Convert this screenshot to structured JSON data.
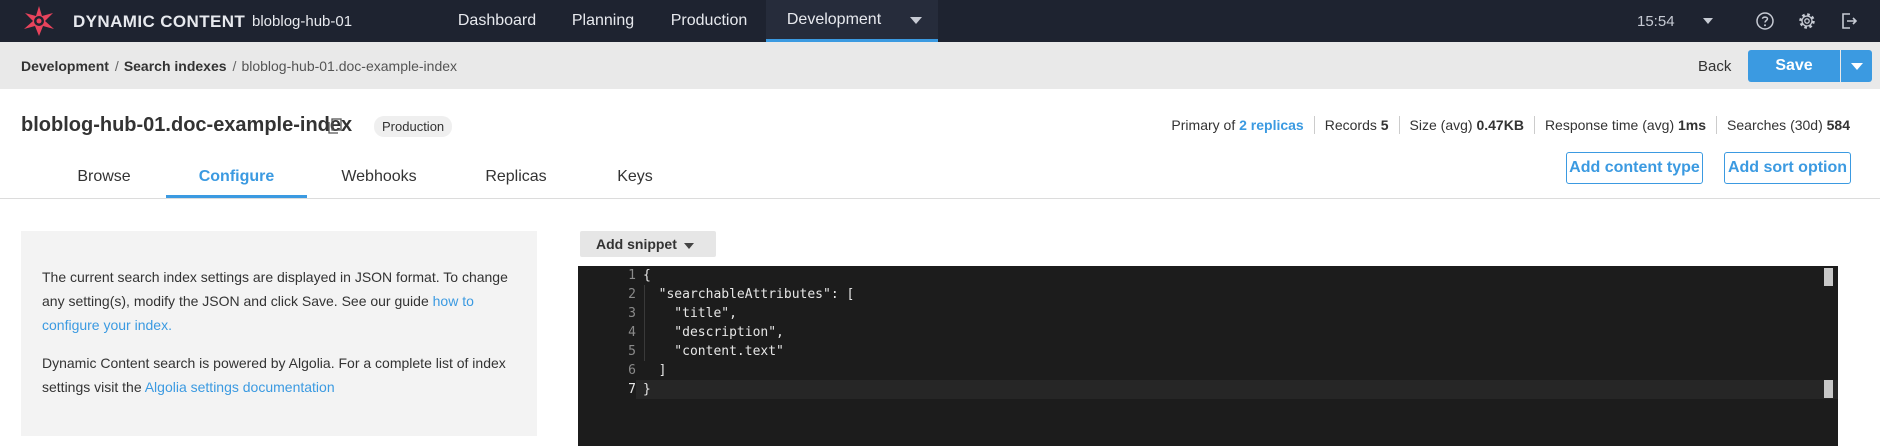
{
  "topbar": {
    "brand": "DYNAMIC CONTENT",
    "hub": "bloblog-hub-01",
    "nav": [
      {
        "label": "Dashboard"
      },
      {
        "label": "Planning"
      },
      {
        "label": "Production"
      },
      {
        "label": "Development"
      }
    ],
    "active_nav": "Development",
    "time": "15:54",
    "icons": [
      "help-icon",
      "settings-icon",
      "logout-icon"
    ]
  },
  "breadcrumb": {
    "items": [
      "Development",
      "Search indexes",
      "bloblog-hub-01.doc-example-index"
    ],
    "separator": "/"
  },
  "actions": {
    "back_label": "Back",
    "save_label": "Save"
  },
  "header": {
    "title": "bloblog-hub-01.doc-example-index",
    "environment": "Production",
    "stats": {
      "primary_prefix": "Primary of",
      "replicas_link": "2 replicas",
      "records_label": "Records",
      "records_value": "5",
      "size_label": "Size (avg)",
      "size_value": "0.47KB",
      "response_label": "Response time (avg)",
      "response_value": "1ms",
      "searches_label": "Searches (30d)",
      "searches_value": "584"
    }
  },
  "tabs": [
    {
      "label": "Browse"
    },
    {
      "label": "Configure"
    },
    {
      "label": "Webhooks"
    },
    {
      "label": "Replicas"
    },
    {
      "label": "Keys"
    }
  ],
  "active_tab": "Configure",
  "tab_actions": {
    "add_content_type": "Add content type",
    "add_sort_option": "Add sort option"
  },
  "info": {
    "p1_text": "The current search index settings are displayed in JSON format. To change any setting(s), modify the JSON and click Save. See our guide ",
    "p1_link": "how to configure your index.",
    "p2_text": "Dynamic Content search is powered by Algolia. For a complete list of index settings visit the ",
    "p2_link": "Algolia settings documentation"
  },
  "editor": {
    "snippet_label": "Add snippet",
    "line_numbers": [
      "1",
      "2",
      "3",
      "4",
      "5",
      "6",
      "7"
    ],
    "current_line": "7",
    "lines": [
      "{",
      "  \"searchableAttributes\": [",
      "    \"title\",",
      "    \"description\",",
      "    \"content.text\"",
      "  ]",
      "}"
    ]
  },
  "colors": {
    "topbar_bg": "#1e2330",
    "accent": "#3b9ae1",
    "crumb_bg": "#e9e9e9",
    "editor_bg": "#1c1c1c"
  }
}
